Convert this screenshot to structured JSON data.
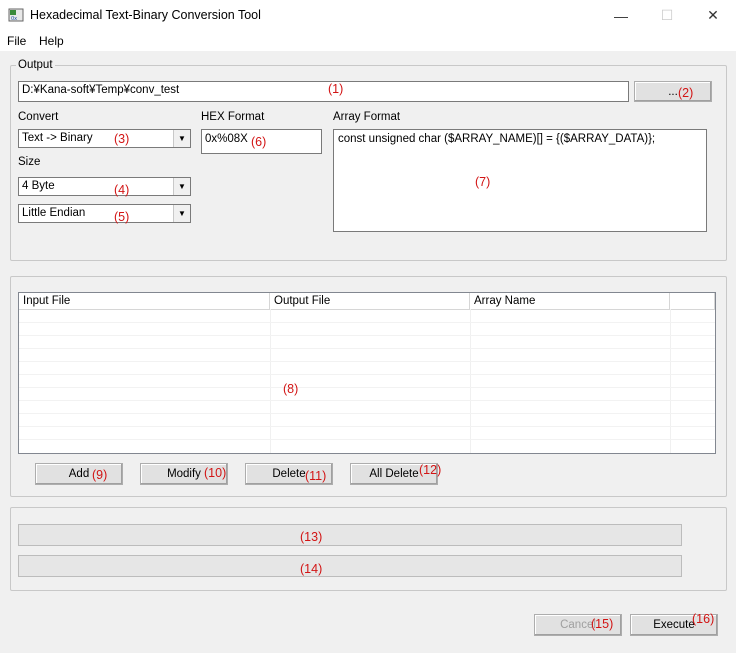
{
  "window": {
    "title": "Hexadecimal Text-Binary Conversion Tool",
    "minimize": "—",
    "maximize": "☐",
    "close": "✕"
  },
  "menu": {
    "file": "File",
    "help": "Help"
  },
  "output_group": {
    "title": "Output",
    "path_value": "D:¥Kana-soft¥Temp¥conv_test",
    "browse_label": "...",
    "convert_label": "Convert",
    "convert_value": "Text -> Binary",
    "size_label": "Size",
    "size_value": "4 Byte",
    "endian_value": "Little Endian",
    "hex_format_label": "HEX Format",
    "hex_format_value": "0x%08X",
    "array_format_label": "Array Format",
    "array_format_value": "const unsigned char ($ARRAY_NAME)[] = {($ARRAY_DATA)};"
  },
  "file_list": {
    "columns": [
      "Input File",
      "Output File",
      "Array Name"
    ],
    "rows": [],
    "add_label": "Add",
    "modify_label": "Modify",
    "delete_label": "Delete",
    "all_delete_label": "All Delete"
  },
  "footer": {
    "cancel_label": "Cancel",
    "execute_label": "Execute"
  },
  "annotations": [
    "(1)",
    "(2)",
    "(3)",
    "(4)",
    "(5)",
    "(6)",
    "(7)",
    "(8)",
    "(9)",
    "(10)",
    "(11)",
    "(12)",
    "(13)",
    "(14)",
    "(15)",
    "(16)"
  ],
  "colors": {
    "annotation": "#d21414",
    "titlebar": "#ffffff",
    "window_bg": "#f0f0f0"
  }
}
